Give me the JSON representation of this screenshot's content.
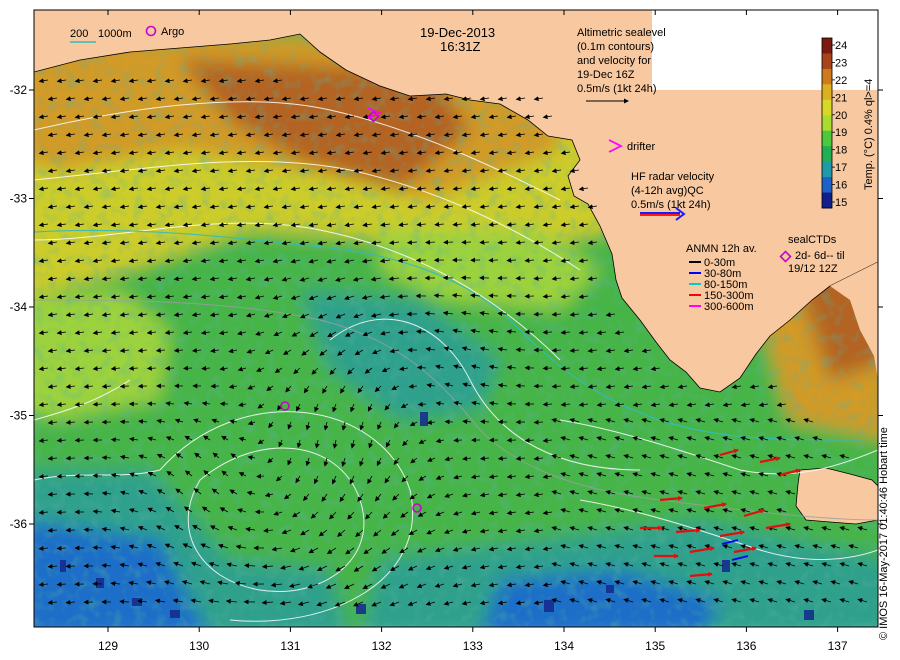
{
  "header": {
    "date": "19-Dec-2013",
    "time": "16:31Z"
  },
  "depth_legend": {
    "label_200": "200",
    "label_1000": "1000m",
    "color_200": "#33bbbb",
    "color_1000": "#888888"
  },
  "argo": {
    "label": "Argo",
    "color": "#cc00cc"
  },
  "altimetry": {
    "lines": [
      "Altimetric sealevel",
      "(0.1m contours)",
      "and velocity for",
      "19-Dec 16Z",
      "0.5m/s (1kt 24h)"
    ]
  },
  "drifter": {
    "label": "drifter",
    "color": "#ff00ff"
  },
  "hf_radar": {
    "lines": [
      "HF radar velocity",
      "(4-12h avg)QC",
      "0.5m/s (1kt 24h)"
    ],
    "color_main": "#1a1aff",
    "color_shadow": "#ff1a1a"
  },
  "seal_ctds": {
    "lines": [
      "sealCTDs",
      "2d- 6d-- til",
      "19/12 12Z"
    ],
    "color": "#cc00cc"
  },
  "anmn": {
    "title": "ANMN 12h av.",
    "items": [
      {
        "label": "0-30m",
        "color": "#000000"
      },
      {
        "label": "30-80m",
        "color": "#0000ff"
      },
      {
        "label": "80-150m",
        "color": "#00cccc"
      },
      {
        "label": "150-300m",
        "color": "#ff0000"
      },
      {
        "label": "300-600m",
        "color": "#ff00ff"
      }
    ]
  },
  "colorbar": {
    "title": "Temp. (°C) 0.4% ql>=4",
    "ticks": [
      "24",
      "23",
      "22",
      "21",
      "20",
      "19",
      "18",
      "17",
      "16",
      "15"
    ],
    "colors": [
      "#7a1a10",
      "#a8441a",
      "#d07a1e",
      "#dcb01e",
      "#d8d826",
      "#a8dc2e",
      "#4cc83c",
      "#22ae52",
      "#1e9aaa",
      "#1e62c8",
      "#121e8c"
    ]
  },
  "axes": {
    "x_ticks": [
      "129",
      "130",
      "131",
      "132",
      "133",
      "134",
      "135",
      "136",
      "137"
    ],
    "y_ticks": [
      "-32",
      "-33",
      "-34",
      "-35",
      "-36"
    ]
  },
  "copyright": "© IMOS 16-May-2017 01:40:46 Hobart time",
  "colors": {
    "land": "#f8c8a0",
    "warm": "#d29a28",
    "hot": "#b46420",
    "yellow": "#cccc2a",
    "light_green": "#9cd23c",
    "green": "#46b446",
    "teal": "#2ea08c",
    "blue": "#1e6ec8",
    "navy": "#14288c"
  }
}
